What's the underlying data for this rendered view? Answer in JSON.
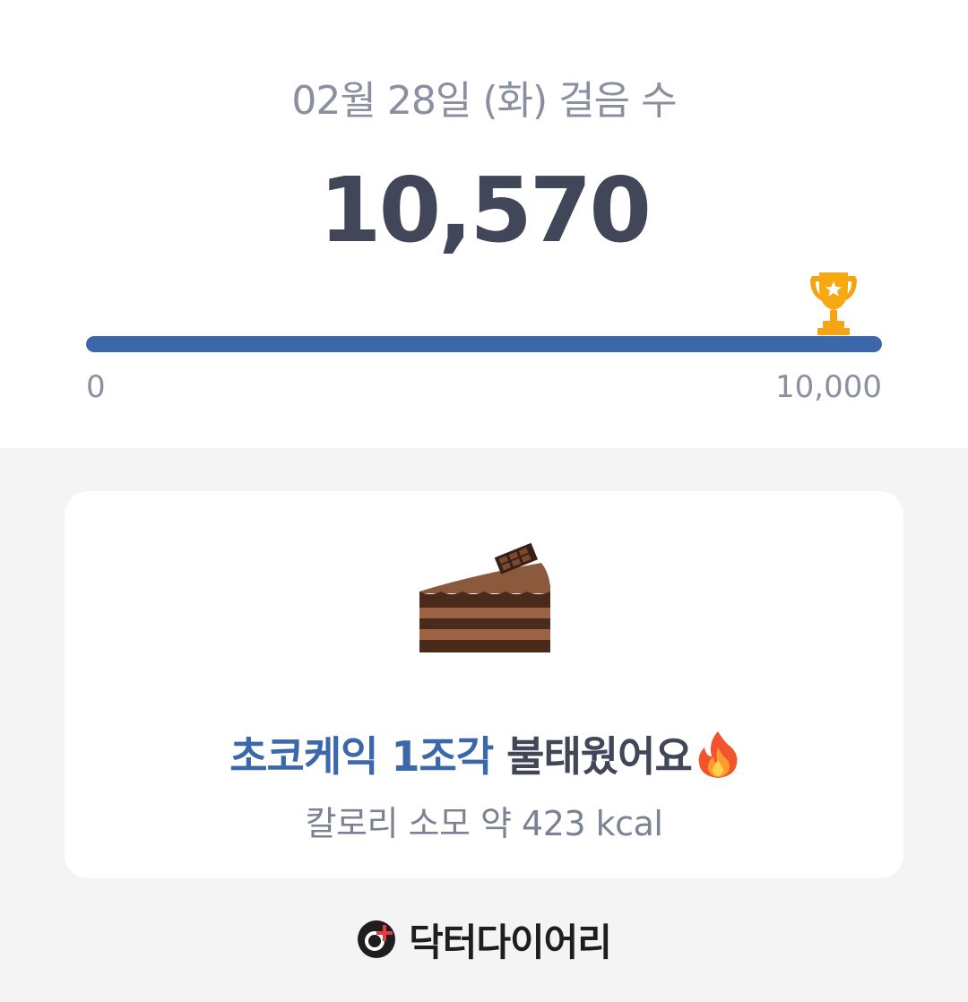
{
  "steps_summary": {
    "title": "02월 28일 (화) 걸음 수",
    "step_count": "10,570",
    "goal_progress": 1.0,
    "scale_min": "0",
    "scale_max": "10,000",
    "trophy_icon": "trophy-icon",
    "progress_color": "#3a68ab"
  },
  "calorie_card": {
    "food_icon": "chocolate-cake-icon",
    "food_text": "초코케익 1조각",
    "burn_text": " 불태웠어요",
    "flame_icon": "fire-icon",
    "kcal_text": "칼로리 소모 약 423 kcal"
  },
  "footer": {
    "brand_icon": "doctor-diary-logo-icon",
    "brand_name": "닥터다이어리"
  }
}
